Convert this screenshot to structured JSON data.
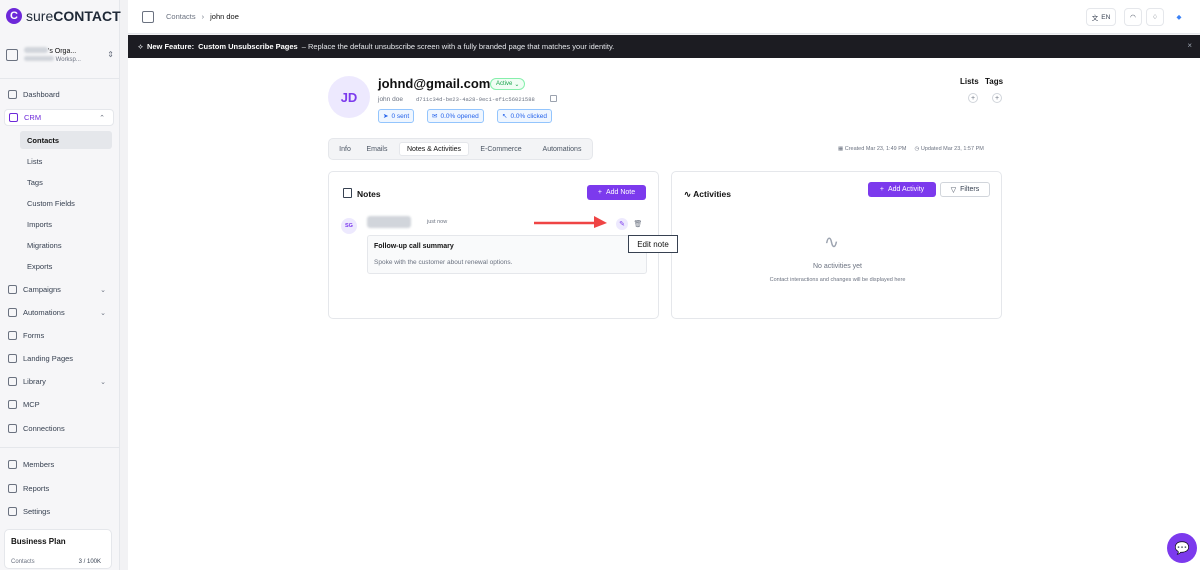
{
  "sidebar": {
    "brand_prefix": "sure",
    "brand_suffix": "CONTACT",
    "org_name": "'s Orga...",
    "org_sub": "Worksp...",
    "nav": {
      "dashboard": "Dashboard",
      "crm": "CRM",
      "campaigns": "Campaigns",
      "automations": "Automations",
      "forms": "Forms",
      "landing_pages": "Landing Pages",
      "library": "Library",
      "mcp": "MCP",
      "connections": "Connections",
      "members": "Members",
      "reports": "Reports",
      "settings": "Settings"
    },
    "crm_sub": [
      "Contacts",
      "Lists",
      "Tags",
      "Custom Fields",
      "Imports",
      "Migrations",
      "Exports"
    ],
    "plan": {
      "title": "Business Plan",
      "label": "Contacts",
      "value": "3 / 100K"
    }
  },
  "topbar": {
    "breadcrumb": [
      "Contacts",
      "john doe"
    ],
    "lang": "EN"
  },
  "banner": {
    "prefix": "New Feature:",
    "title": "Custom Unsubscribe Pages",
    "text": "– Replace the default unsubscribe screen with a fully branded page that matches your identity."
  },
  "contact": {
    "initials": "JD",
    "email": "johnd@gmail.com",
    "status": "Active",
    "name": "john doe",
    "id": "d711c34d-be23-4a28-9ec1-ef1c56021588",
    "stats": {
      "sent": "0 sent",
      "opened": "0.0% opened",
      "clicked": "0.0% clicked"
    },
    "lists_label": "Lists",
    "tags_label": "Tags",
    "created": "Created Mar 23, 1:49 PM",
    "updated": "Updated Mar 23, 1:57 PM"
  },
  "tabs": [
    "Info",
    "Emails",
    "Notes & Activities",
    "E-Commerce",
    "Automations"
  ],
  "notes": {
    "title": "Notes",
    "add_label": "Add Note",
    "item": {
      "initials": "SG",
      "time": "just now",
      "title": "Follow-up call summary",
      "body": "Spoke with the customer about renewal options."
    },
    "tooltip": "Edit note"
  },
  "activities": {
    "title": "Activities",
    "add_label": "Add Activity",
    "filters_label": "Filters",
    "empty_title": "No activities yet",
    "empty_sub": "Contact interactions and changes will be displayed here"
  },
  "colors": {
    "accent": "#7c3aed",
    "annotation": "#ef4444"
  }
}
